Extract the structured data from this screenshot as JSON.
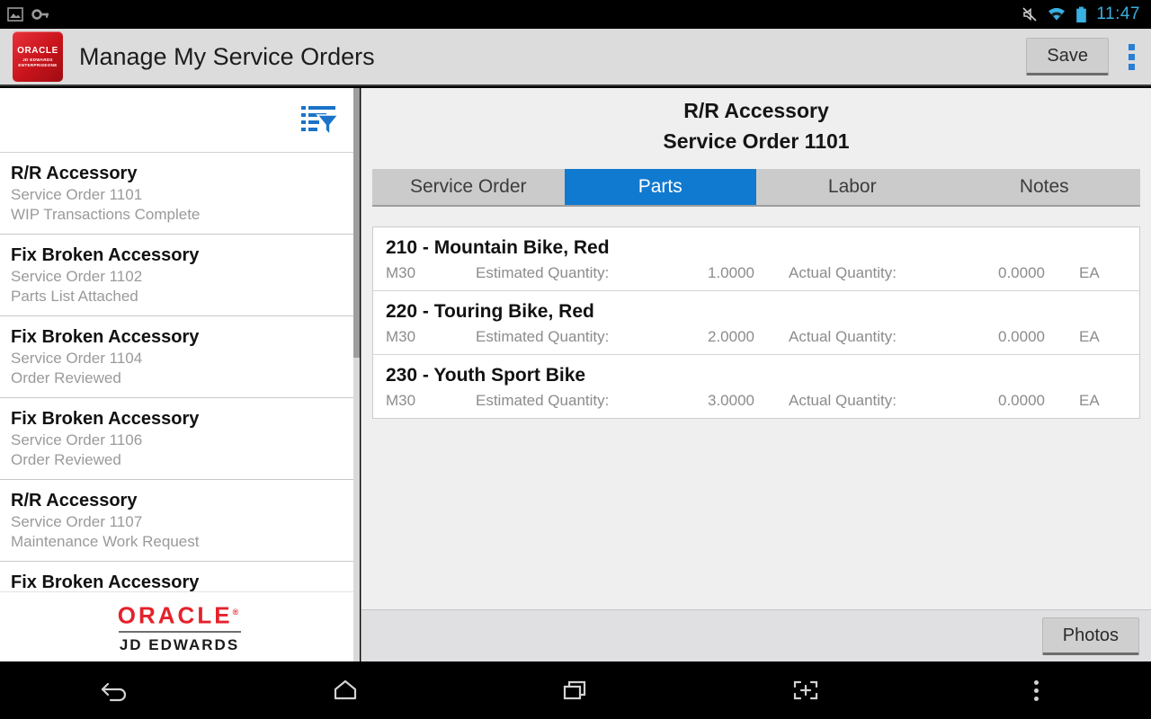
{
  "statusbar": {
    "icons_left": [
      "screenshot-image-icon",
      "vpn-key-icon"
    ],
    "icons_right": [
      "mute-icon",
      "wifi-icon",
      "battery-icon"
    ],
    "clock": "11:47",
    "clock_color": "#3ab0e2"
  },
  "appbar": {
    "logo": {
      "line1": "ORACLE",
      "line2": "JD EDWARDS",
      "line3": "ENTERPRISEONE"
    },
    "title": "Manage My Service Orders",
    "save_label": "Save",
    "overflow_icon": "kebab-menu-icon",
    "accent_blue": "#2a7fd4"
  },
  "sidebar": {
    "filter_icon": "filter-list-icon",
    "items": [
      {
        "title": "R/R Accessory",
        "order": "Service Order 1101",
        "status": "WIP Transactions Complete"
      },
      {
        "title": "Fix Broken Accessory",
        "order": "Service Order 1102",
        "status": "Parts List Attached"
      },
      {
        "title": "Fix Broken Accessory",
        "order": "Service Order 1104",
        "status": "Order Reviewed"
      },
      {
        "title": "Fix Broken Accessory",
        "order": "Service Order 1106",
        "status": "Order Reviewed"
      },
      {
        "title": "R/R Accessory",
        "order": "Service Order 1107",
        "status": "Maintenance Work Request"
      },
      {
        "title": "Fix Broken Accessory",
        "order": "",
        "status": ""
      }
    ],
    "branding": {
      "oracle": "ORACLE",
      "registered": "®",
      "product": "JD EDWARDS",
      "oracle_color": "#e4222b"
    }
  },
  "detail": {
    "title": "R/R Accessory",
    "subtitle": "Service Order 1101",
    "tabs": [
      {
        "label": "Service Order",
        "active": false
      },
      {
        "label": "Parts",
        "active": true
      },
      {
        "label": "Labor",
        "active": false
      },
      {
        "label": "Notes",
        "active": false
      }
    ],
    "active_tab_color": "#1079d0",
    "labels": {
      "estimated": "Estimated Quantity:",
      "actual": "Actual Quantity:"
    },
    "parts": [
      {
        "name": "210 - Mountain Bike, Red",
        "branch": "M30",
        "est_label": "Estimated Quantity:",
        "est_qty": "1.0000",
        "act_label": "Actual Quantity:",
        "act_qty": "0.0000",
        "uom": "EA"
      },
      {
        "name": "220 - Touring Bike, Red",
        "branch": "M30",
        "est_label": "Estimated Quantity:",
        "est_qty": "2.0000",
        "act_label": "Actual Quantity:",
        "act_qty": "0.0000",
        "uom": "EA"
      },
      {
        "name": "230 - Youth Sport Bike",
        "branch": "M30",
        "est_label": "Estimated Quantity:",
        "est_qty": "3.0000",
        "act_label": "Actual Quantity:",
        "act_qty": "0.0000",
        "uom": "EA"
      }
    ],
    "photos_label": "Photos"
  },
  "navbar": {
    "buttons": [
      "back-icon",
      "home-icon",
      "recents-icon",
      "screenshot-icon",
      "menu-icon"
    ]
  }
}
